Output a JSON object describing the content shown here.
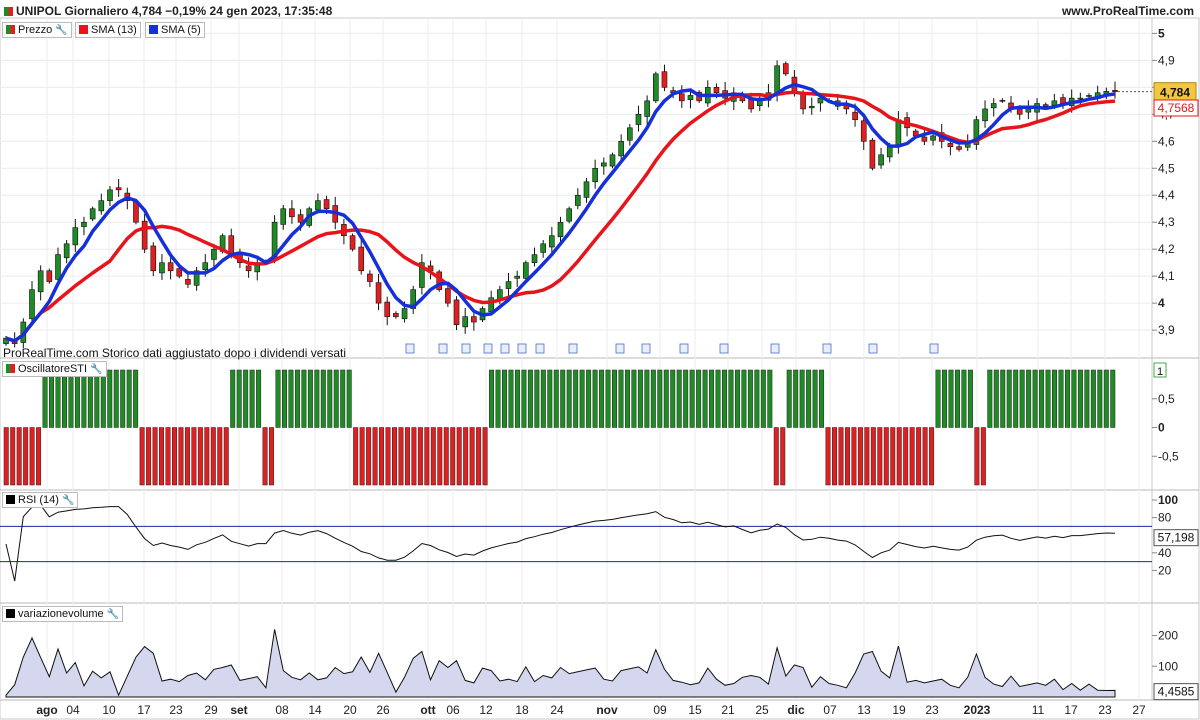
{
  "header": {
    "title": "UNIPOL Giornaliero 4,784 −0,19% 24 gen 2023, 17:35:48",
    "website": "www.ProRealTime.com"
  },
  "legend": {
    "price": "Prezzo",
    "sma13": "SMA (13)",
    "sma5": "SMA (5)"
  },
  "notice": "ProRealTime.com  Storico dati aggiustato dopo i dividendi versati",
  "panels": {
    "sti": {
      "label": "OscillatoreSTI",
      "badge": "1"
    },
    "rsi": {
      "label": "RSI (14)"
    },
    "vol": {
      "label": "variazionevolume"
    }
  },
  "colors": {
    "up": "#1f8b24",
    "down": "#e02020",
    "sma13": "#e8141b",
    "sma5": "#1530d8",
    "highlight": "#f3c63b"
  },
  "chart_data": [
    {
      "type": "candlestick",
      "title": "UNIPOL Giornaliero",
      "ylim": [
        3.83,
        5.02
      ],
      "y_ticks": [
        "5",
        "4,9",
        "4,8",
        "4,7",
        "4,6",
        "4,5",
        "4,4",
        "4,3",
        "4,2",
        "4,1",
        "4",
        "3,9"
      ],
      "last_price": "4,784",
      "sma13_last": "4,7568",
      "x_tick_labels": [
        "ago",
        "04",
        "10",
        "17",
        "23",
        "29",
        "set",
        "08",
        "14",
        "20",
        "26",
        "ott",
        "06",
        "12",
        "18",
        "24",
        "nov",
        "09",
        "15",
        "21",
        "25",
        "dic",
        "07",
        "13",
        "19",
        "23",
        "2023",
        "11",
        "17",
        "23",
        "27"
      ],
      "closes": [
        3.87,
        3.85,
        3.93,
        4.05,
        4.12,
        4.08,
        4.18,
        4.22,
        4.28,
        4.3,
        4.35,
        4.38,
        4.42,
        4.42,
        4.38,
        4.3,
        4.2,
        4.12,
        4.15,
        4.12,
        4.1,
        4.07,
        4.12,
        4.15,
        4.2,
        4.25,
        4.18,
        4.15,
        4.12,
        4.15,
        4.15,
        4.3,
        4.35,
        4.32,
        4.3,
        4.35,
        4.38,
        4.35,
        4.3,
        4.25,
        4.2,
        4.12,
        4.08,
        4.0,
        3.95,
        3.95,
        3.98,
        4.05,
        4.15,
        4.12,
        4.05,
        4.0,
        3.92,
        3.95,
        3.93,
        3.98,
        4.02,
        4.05,
        4.08,
        4.1,
        4.15,
        4.18,
        4.22,
        4.25,
        4.3,
        4.35,
        4.4,
        4.45,
        4.5,
        4.52,
        4.55,
        4.6,
        4.65,
        4.7,
        4.75,
        4.85,
        4.8,
        4.78,
        4.75,
        4.77,
        4.75,
        4.8,
        4.78,
        4.76,
        4.78,
        4.75,
        4.72,
        4.76,
        4.78,
        4.88,
        4.85,
        4.78,
        4.72,
        4.73,
        4.76,
        4.75,
        4.73,
        4.72,
        4.68,
        4.6,
        4.5,
        4.55,
        4.58,
        4.68,
        4.65,
        4.62,
        4.6,
        4.62,
        4.6,
        4.58,
        4.57,
        4.6,
        4.68,
        4.72,
        4.74,
        4.75,
        4.72,
        4.7,
        4.72,
        4.74,
        4.73,
        4.75,
        4.74,
        4.76,
        4.76,
        4.77,
        4.78,
        4.785,
        4.784
      ]
    },
    {
      "type": "bar",
      "title": "OscillatoreSTI",
      "ylim": [
        -1,
        1
      ],
      "y_ticks": [
        "0,5",
        "0",
        "-0,5"
      ],
      "values": [
        -1,
        -1,
        -1,
        -1,
        -1,
        -1,
        1,
        1,
        1,
        1,
        1,
        1,
        1,
        1,
        1,
        1,
        1,
        1,
        1,
        1,
        1,
        -1,
        -1,
        -1,
        -1,
        -1,
        -1,
        -1,
        -1,
        -1,
        -1,
        -1,
        -1,
        -1,
        -1,
        1,
        1,
        1,
        1,
        1,
        -1,
        -1,
        1,
        1,
        1,
        1,
        1,
        1,
        1,
        1,
        1,
        1,
        1,
        1,
        -1,
        -1,
        -1,
        -1,
        -1,
        -1,
        -1,
        -1,
        -1,
        -1,
        -1,
        -1,
        -1,
        -1,
        -1,
        -1,
        -1,
        -1,
        -1,
        -1,
        -1,
        1,
        1,
        1,
        1,
        1,
        1,
        1,
        1,
        1,
        1,
        1,
        1,
        1,
        1,
        1,
        1,
        1,
        1,
        1,
        1,
        1,
        1,
        1,
        1,
        1,
        1,
        1,
        1,
        1,
        1,
        1,
        1,
        1,
        1,
        1,
        1,
        1,
        1,
        1,
        1,
        1,
        1,
        1,
        1,
        -1,
        -1,
        1,
        1,
        1,
        1,
        1,
        1,
        -1,
        -1,
        -1,
        -1,
        -1,
        -1,
        -1,
        -1,
        -1,
        -1,
        -1,
        -1,
        -1,
        -1,
        -1,
        -1,
        -1,
        1,
        1,
        1,
        1,
        1,
        1,
        -1,
        -1,
        1,
        1,
        1,
        1,
        1,
        1,
        1,
        1,
        1,
        1,
        1,
        1,
        1,
        1,
        1,
        1,
        1,
        1,
        1,
        1
      ]
    },
    {
      "type": "line",
      "title": "RSI (14)",
      "ylim": [
        0,
        100
      ],
      "y_ticks": [
        "100",
        "80",
        "40",
        "20"
      ],
      "levels": [
        70,
        30
      ],
      "last_value": "57,198"
    },
    {
      "type": "area",
      "title": "variazionevolume",
      "ylim": [
        0,
        270
      ],
      "y_ticks": [
        "200",
        "100"
      ],
      "last_value": "4,4585"
    }
  ]
}
